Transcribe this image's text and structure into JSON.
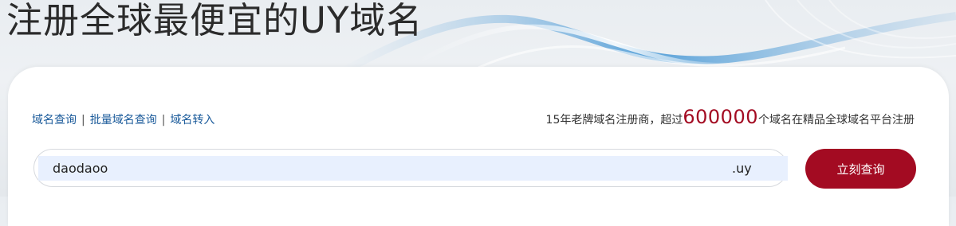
{
  "hero": {
    "title": "注册全球最便宜的UY域名"
  },
  "nav_links": {
    "domain_search": "域名查询",
    "sep1": "|",
    "bulk_search": "批量域名查询",
    "sep2": "|",
    "transfer": "域名转入"
  },
  "promo": {
    "prefix": "15年老牌域名注册商，超过",
    "count": "600000",
    "suffix": "个域名在精品全球域名平台注册"
  },
  "search": {
    "value": "daodaoo",
    "suffix": ".uy",
    "button_label": "立刻查询"
  },
  "colors": {
    "accent": "#a30b22",
    "link": "#1a5a9a",
    "input_bg": "#e8f0fe"
  }
}
